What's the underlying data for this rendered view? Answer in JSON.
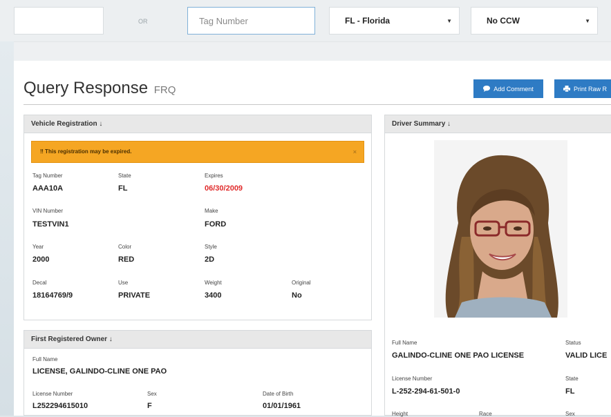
{
  "search": {
    "or_label": "OR",
    "tag_placeholder": "Tag Number",
    "state_select": "FL - Florida",
    "ccw_select": "No CCW"
  },
  "header": {
    "title": "Query Response",
    "subtitle": "FRQ",
    "add_comment": "Add Comment",
    "print_raw": "Print Raw R"
  },
  "vehicle": {
    "heading": "Vehicle Registration ↓",
    "alert": "‼ This registration may be expired.",
    "alert_close": "×",
    "tag_label": "Tag Number",
    "tag_value": "AAA10A",
    "state_label": "State",
    "state_value": "FL",
    "expires_label": "Expires",
    "expires_value": "06/30/2009",
    "vin_label": "VIN Number",
    "vin_value": "TESTVIN1",
    "make_label": "Make",
    "make_value": "FORD",
    "year_label": "Year",
    "year_value": "2000",
    "color_label": "Color",
    "color_value": "RED",
    "style_label": "Style",
    "style_value": "2D",
    "decal_label": "Decal",
    "decal_value": "18164769/9",
    "use_label": "Use",
    "use_value": "PRIVATE",
    "weight_label": "Weight",
    "weight_value": "3400",
    "original_label": "Original",
    "original_value": "No"
  },
  "owner": {
    "heading": "First Registered Owner ↓",
    "name_label": "Full Name",
    "name_value": "LICENSE, GALINDO-CLINE ONE PAO",
    "license_label": "License Number",
    "license_value": "L252294615010",
    "sex_label": "Sex",
    "sex_value": "F",
    "dob_label": "Date of Birth",
    "dob_value": "01/01/1961"
  },
  "driver": {
    "heading": "Driver Summary ↓",
    "name_label": "Full Name",
    "name_value": "GALINDO-CLINE ONE PAO LICENSE",
    "status_label": "Status",
    "status_value": "VALID LICE",
    "license_label": "License Number",
    "license_value": "L-252-294-61-501-0",
    "state_label": "State",
    "state_value": "FL",
    "height_label": "Height",
    "race_label": "Race",
    "sex_label": "Sex"
  },
  "colors": {
    "accent": "#2e7bc4",
    "alert": "#f5a623",
    "expired": "#e02a2a"
  },
  "icons": {
    "comment": "comment-icon",
    "print": "print-icon"
  }
}
